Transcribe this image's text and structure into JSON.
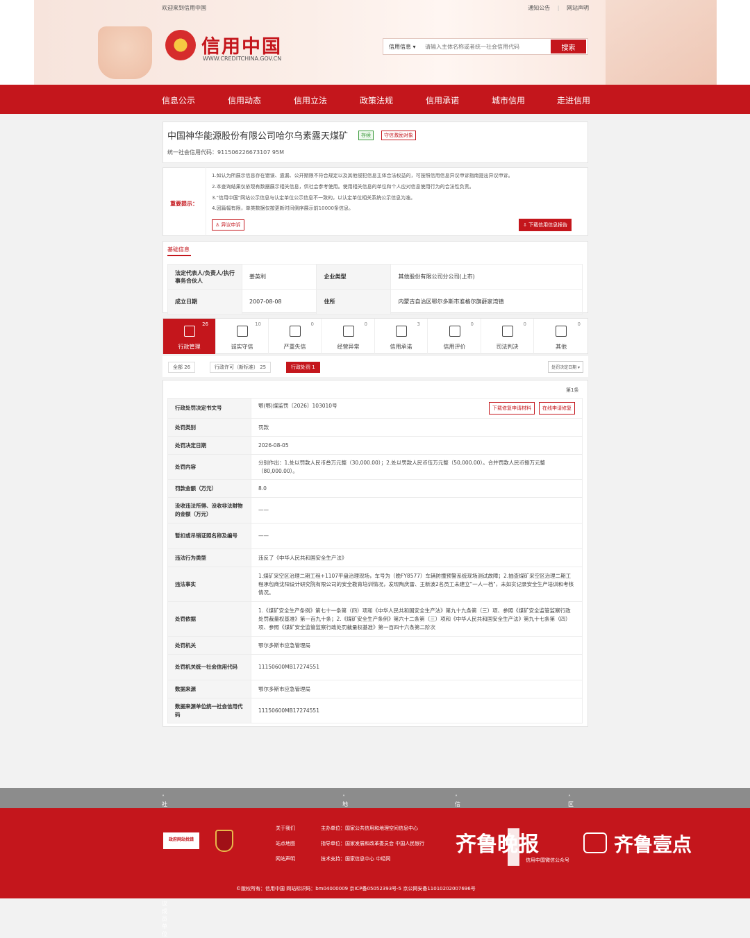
{
  "header": {
    "welcome": "欢迎来到信用中国",
    "links": [
      "通知公告",
      "网站声明"
    ],
    "logo_cn": "信用中国",
    "logo_en": "WWW.CREDITCHINA.GOV.CN"
  },
  "search": {
    "select": "信用信息",
    "placeholder": "请输入主体名称或者统一社会信用代码",
    "button": "搜索"
  },
  "nav": [
    "信息公示",
    "信用动态",
    "信用立法",
    "政策法规",
    "信用承诺",
    "城市信用",
    "走进信用"
  ],
  "company": {
    "name": "中国神华能源股份有限公司哈尔乌素露天煤矿",
    "status": "存续",
    "tag": "守信激励对象",
    "code": "统一社会信用代码：911506226673107 95M"
  },
  "tips": {
    "label": "重要提示：",
    "items": [
      "1.如认为所展示信息存在错误、遗漏、公开期限不符合规定以及其他侵犯信息主体合法权益的，可按照信用信息异议申诉指南提出异议申诉。",
      "2.本查询结果仅依现有数据展示相关信息，供社会参考使用。使用相关信息的单位和个人应对信息使用行为的合法性负责。",
      "3.\"信用中国\"网站公示信息与认定单位公示信息不一致的，以认定单位相关系统公示信息为准。",
      "4.因篇幅有限，单类数据仅按更新时间倒序展示前10000条信息。"
    ],
    "objection": "异议申诉",
    "download": "下载信用信息报告"
  },
  "basic": {
    "title": "基础信息",
    "rows": [
      [
        "法定代表人/负责人/执行事务合伙人",
        "姜英利",
        "企业类型",
        "其他股份有限公司分公司(上市)"
      ],
      [
        "成立日期",
        "2007-08-08",
        "住所",
        "内蒙古自治区鄂尔多斯市准格尔旗薛家湾镇"
      ]
    ]
  },
  "tabs": [
    {
      "label": "行政管理",
      "count": "26"
    },
    {
      "label": "诚实守信",
      "count": "10"
    },
    {
      "label": "严重失信",
      "count": "0"
    },
    {
      "label": "经营异常",
      "count": "0"
    },
    {
      "label": "信用承诺",
      "count": "3"
    },
    {
      "label": "信用评价",
      "count": "0"
    },
    {
      "label": "司法判决",
      "count": "0"
    },
    {
      "label": "其他",
      "count": "0"
    }
  ],
  "subtabs": [
    "全部  26",
    "行政许可（新标准）  25",
    "行政处罚  1"
  ],
  "sort": "处罚决定日期",
  "count_text": "第1条",
  "detail": {
    "actions": [
      "下载修复申请材料",
      "在线申请修复"
    ],
    "rows": [
      [
        "行政处罚决定书文号",
        "鄂(鄂)煤监罚〔2026〕103010号"
      ],
      [
        "处罚类别",
        "罚款"
      ],
      [
        "处罚决定日期",
        "2026-08-05"
      ],
      [
        "处罚内容",
        "分别作出：1.处以罚款人民币叁万元整（30,000.00）；2.处以罚款人民币伍万元整（50,000.00）。合并罚款人民币捌万元整（80,000.00）。"
      ],
      [
        "罚款金额（万元）",
        "8.0"
      ],
      [
        "没收违法所得、没收非法财物的金额（万元）",
        "——"
      ],
      [
        "暂扣或吊销证照名称及编号",
        "——"
      ],
      [
        "违法行为类型",
        "违反了《中华人民共和国安全生产法》"
      ],
      [
        "违法事实",
        "1.煤矿采空区治理二期工程+1107平盘治理现场，车号为（晚FY8577）车辆防撞预警系统现场测试故障；2.抽查煤矿采空区治理二期工程承包商沈阳设计研究院有限公司的安全教育培训情况，发现陶庆雷、王新波2名员工未建立\"一人一档\"，未如实记录安全生产培训和考核情况。"
      ],
      [
        "处罚依据",
        "1.《煤矿安全生产条例》第七十一条第（四）项和《中华人民共和国安全生产法》第九十九条第（三）项、参照《煤矿安全监管监察行政处罚裁量权基准》第一百九十条；2.《煤矿安全生产条例》第六十二条第（三）项和《中华人民共和国安全生产法》第九十七条第（四）项、参照《煤矿安全监管监察行政处罚裁量权基准》第一百四十六条第二阶次"
      ],
      [
        "处罚机关",
        "鄂尔多斯市应急管理局"
      ],
      [
        "处罚机关统一社会信用代码",
        "11150600MB17274551"
      ],
      [
        "数据来源",
        "鄂尔多斯市应急管理局"
      ],
      [
        "数据来源单位统一社会信用代码",
        "11150600MB17274551"
      ]
    ]
  },
  "footnav": [
    "社会信用体系建设部际联席会议成员单位",
    "地方信用网站",
    "信用示范地区",
    "区域"
  ],
  "footer": {
    "links": [
      "关于我们",
      "站点地图",
      "网站声明"
    ],
    "orgs": [
      "主办单位：国家公共信用和地理空间信息中心",
      "指导单位：国家发展和改革委员会 中国人民银行",
      "技术支持：国家信息中心 中经网"
    ],
    "gov": "政府网站找错",
    "copyright": "©版权所有：信用中国   网站标识码：bm04000009   京ICP备05052393号-5   京公网安备11010202007696号",
    "wechat": "信用中国微信公众号",
    "wm1": "齐鲁晚报",
    "wm2": "齐鲁壹点"
  }
}
